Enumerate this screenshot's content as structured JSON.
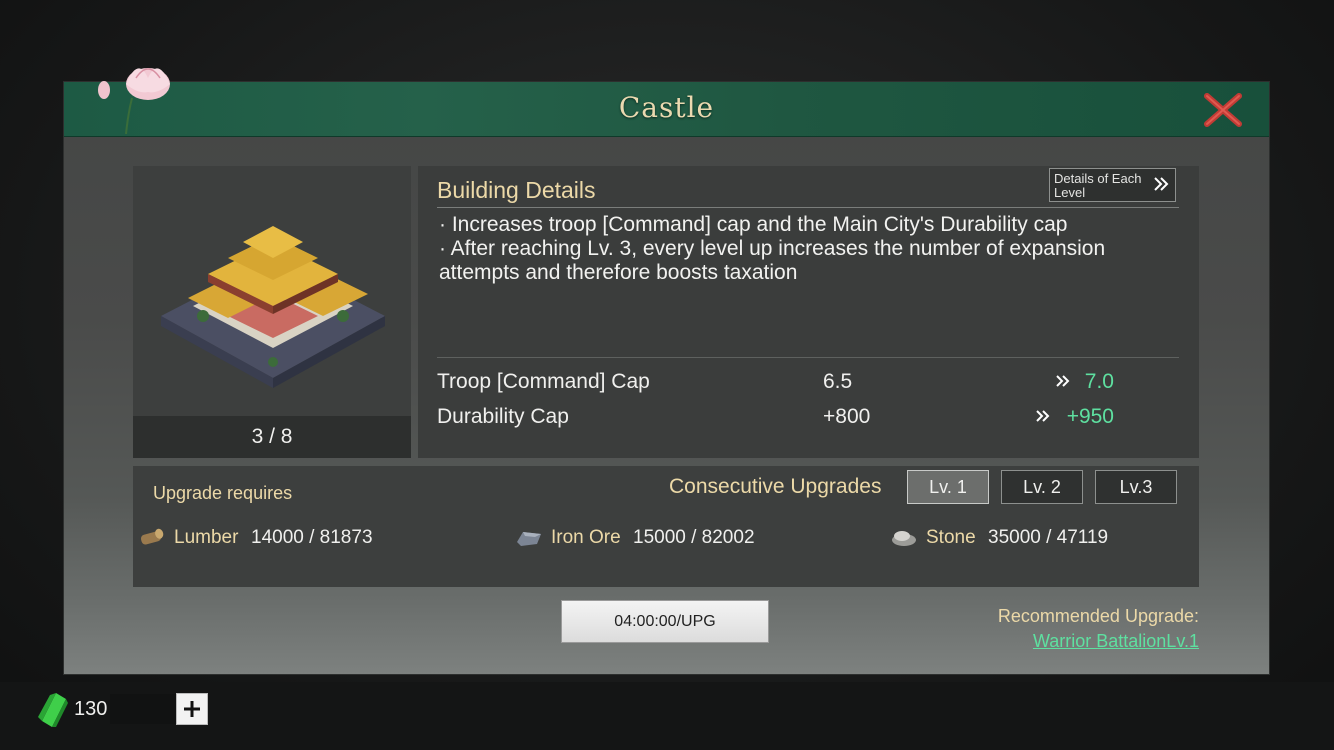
{
  "window": {
    "title": "Castle"
  },
  "building": {
    "level_count": "3 / 8"
  },
  "details": {
    "heading": "Building Details",
    "each_level_button": "Details of Each Level",
    "description_lines": [
      "·  Increases troop [Command] cap and the Main City's Durability cap",
      "·  After reaching Lv. 3, every level up increases the number of expansion attempts and therefore boosts taxation"
    ],
    "stats": [
      {
        "name": "Troop [Command] Cap",
        "current": "6.5",
        "next": "7.0"
      },
      {
        "name": "Durability Cap",
        "current": "+800",
        "next": "+950"
      }
    ]
  },
  "upgrade": {
    "requires_label": "Upgrade requires",
    "consecutive_label": "Consecutive Upgrades",
    "levels": [
      "Lv. 1",
      "Lv. 2",
      "Lv.3"
    ],
    "selected_level": "Lv. 1",
    "resources": [
      {
        "name": "Lumber",
        "amount": "14000 / 81873",
        "icon": "lumber-icon"
      },
      {
        "name": "Iron Ore",
        "amount": "15000 / 82002",
        "icon": "iron-ore-icon"
      },
      {
        "name": "Stone",
        "amount": "35000 / 47119",
        "icon": "stone-icon"
      }
    ],
    "timer_button": "04:00:00/UPG",
    "recommended_label": "Recommended Upgrade:",
    "recommended_link": "Warrior BattalionLv.1"
  },
  "currency": {
    "jade_amount": "130",
    "icon": "jade-icon"
  },
  "colors": {
    "title_bar": "#1d5a44",
    "accent_gold": "#ecd9a8",
    "value_green": "#5ee0a0",
    "close_red": "#c23b35"
  }
}
